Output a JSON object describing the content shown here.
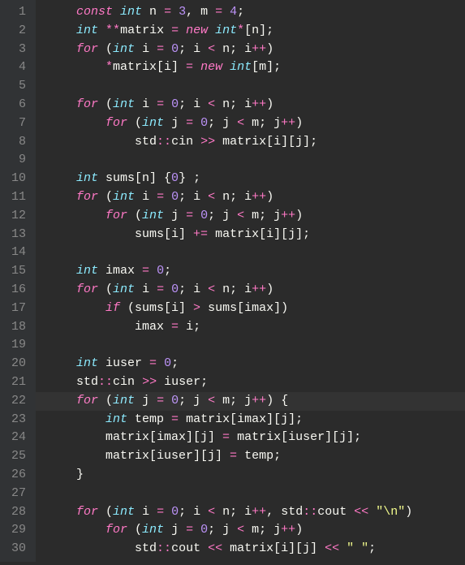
{
  "editor": {
    "cursor_line": 22,
    "lines": [
      {
        "n": 1,
        "indent": 1,
        "tokens": [
          {
            "t": "const ",
            "c": "kw"
          },
          {
            "t": "int",
            "c": "type"
          },
          {
            "t": " n ",
            "c": "id"
          },
          {
            "t": "=",
            "c": "op"
          },
          {
            "t": " ",
            "c": "id"
          },
          {
            "t": "3",
            "c": "num"
          },
          {
            "t": ", m ",
            "c": "id"
          },
          {
            "t": "=",
            "c": "op"
          },
          {
            "t": " ",
            "c": "id"
          },
          {
            "t": "4",
            "c": "num"
          },
          {
            "t": ";",
            "c": "pn"
          }
        ]
      },
      {
        "n": 2,
        "indent": 1,
        "tokens": [
          {
            "t": "int",
            "c": "type"
          },
          {
            "t": " ",
            "c": "id"
          },
          {
            "t": "**",
            "c": "op"
          },
          {
            "t": "matrix ",
            "c": "id"
          },
          {
            "t": "=",
            "c": "op"
          },
          {
            "t": " ",
            "c": "id"
          },
          {
            "t": "new ",
            "c": "kw"
          },
          {
            "t": "int",
            "c": "type"
          },
          {
            "t": "*",
            "c": "op"
          },
          {
            "t": "[n];",
            "c": "pn"
          }
        ]
      },
      {
        "n": 3,
        "indent": 1,
        "tokens": [
          {
            "t": "for",
            "c": "kw"
          },
          {
            "t": " (",
            "c": "pn"
          },
          {
            "t": "int",
            "c": "type"
          },
          {
            "t": " i ",
            "c": "id"
          },
          {
            "t": "=",
            "c": "op"
          },
          {
            "t": " ",
            "c": "id"
          },
          {
            "t": "0",
            "c": "num"
          },
          {
            "t": "; i ",
            "c": "id"
          },
          {
            "t": "<",
            "c": "op"
          },
          {
            "t": " n; i",
            "c": "id"
          },
          {
            "t": "++",
            "c": "op"
          },
          {
            "t": ")",
            "c": "pn"
          }
        ]
      },
      {
        "n": 4,
        "indent": 2,
        "tokens": [
          {
            "t": "*",
            "c": "op"
          },
          {
            "t": "matrix[i] ",
            "c": "id"
          },
          {
            "t": "=",
            "c": "op"
          },
          {
            "t": " ",
            "c": "id"
          },
          {
            "t": "new ",
            "c": "kw"
          },
          {
            "t": "int",
            "c": "type"
          },
          {
            "t": "[m];",
            "c": "pn"
          }
        ]
      },
      {
        "n": 5,
        "indent": 0,
        "tokens": []
      },
      {
        "n": 6,
        "indent": 1,
        "tokens": [
          {
            "t": "for",
            "c": "kw"
          },
          {
            "t": " (",
            "c": "pn"
          },
          {
            "t": "int",
            "c": "type"
          },
          {
            "t": " i ",
            "c": "id"
          },
          {
            "t": "=",
            "c": "op"
          },
          {
            "t": " ",
            "c": "id"
          },
          {
            "t": "0",
            "c": "num"
          },
          {
            "t": "; i ",
            "c": "id"
          },
          {
            "t": "<",
            "c": "op"
          },
          {
            "t": " n; i",
            "c": "id"
          },
          {
            "t": "++",
            "c": "op"
          },
          {
            "t": ")",
            "c": "pn"
          }
        ]
      },
      {
        "n": 7,
        "indent": 2,
        "tokens": [
          {
            "t": "for",
            "c": "kw"
          },
          {
            "t": " (",
            "c": "pn"
          },
          {
            "t": "int",
            "c": "type"
          },
          {
            "t": " j ",
            "c": "id"
          },
          {
            "t": "=",
            "c": "op"
          },
          {
            "t": " ",
            "c": "id"
          },
          {
            "t": "0",
            "c": "num"
          },
          {
            "t": "; j ",
            "c": "id"
          },
          {
            "t": "<",
            "c": "op"
          },
          {
            "t": " m; j",
            "c": "id"
          },
          {
            "t": "++",
            "c": "op"
          },
          {
            "t": ")",
            "c": "pn"
          }
        ]
      },
      {
        "n": 8,
        "indent": 3,
        "tokens": [
          {
            "t": "std",
            "c": "id"
          },
          {
            "t": "::",
            "c": "op"
          },
          {
            "t": "cin ",
            "c": "fn"
          },
          {
            "t": ">>",
            "c": "op"
          },
          {
            "t": " matrix[i][j];",
            "c": "id"
          }
        ]
      },
      {
        "n": 9,
        "indent": 0,
        "tokens": []
      },
      {
        "n": 10,
        "indent": 1,
        "tokens": [
          {
            "t": "int",
            "c": "type"
          },
          {
            "t": " sums[n] {",
            "c": "id"
          },
          {
            "t": "0",
            "c": "num"
          },
          {
            "t": "} ;",
            "c": "id"
          }
        ]
      },
      {
        "n": 11,
        "indent": 1,
        "tokens": [
          {
            "t": "for",
            "c": "kw"
          },
          {
            "t": " (",
            "c": "pn"
          },
          {
            "t": "int",
            "c": "type"
          },
          {
            "t": " i ",
            "c": "id"
          },
          {
            "t": "=",
            "c": "op"
          },
          {
            "t": " ",
            "c": "id"
          },
          {
            "t": "0",
            "c": "num"
          },
          {
            "t": "; i ",
            "c": "id"
          },
          {
            "t": "<",
            "c": "op"
          },
          {
            "t": " n; i",
            "c": "id"
          },
          {
            "t": "++",
            "c": "op"
          },
          {
            "t": ")",
            "c": "pn"
          }
        ]
      },
      {
        "n": 12,
        "indent": 2,
        "tokens": [
          {
            "t": "for",
            "c": "kw"
          },
          {
            "t": " (",
            "c": "pn"
          },
          {
            "t": "int",
            "c": "type"
          },
          {
            "t": " j ",
            "c": "id"
          },
          {
            "t": "=",
            "c": "op"
          },
          {
            "t": " ",
            "c": "id"
          },
          {
            "t": "0",
            "c": "num"
          },
          {
            "t": "; j ",
            "c": "id"
          },
          {
            "t": "<",
            "c": "op"
          },
          {
            "t": " m; j",
            "c": "id"
          },
          {
            "t": "++",
            "c": "op"
          },
          {
            "t": ")",
            "c": "pn"
          }
        ]
      },
      {
        "n": 13,
        "indent": 3,
        "tokens": [
          {
            "t": "sums[i] ",
            "c": "id"
          },
          {
            "t": "+=",
            "c": "op"
          },
          {
            "t": " matrix[i][j];",
            "c": "id"
          }
        ]
      },
      {
        "n": 14,
        "indent": 0,
        "tokens": []
      },
      {
        "n": 15,
        "indent": 1,
        "tokens": [
          {
            "t": "int",
            "c": "type"
          },
          {
            "t": " imax ",
            "c": "id"
          },
          {
            "t": "=",
            "c": "op"
          },
          {
            "t": " ",
            "c": "id"
          },
          {
            "t": "0",
            "c": "num"
          },
          {
            "t": ";",
            "c": "pn"
          }
        ]
      },
      {
        "n": 16,
        "indent": 1,
        "tokens": [
          {
            "t": "for",
            "c": "kw"
          },
          {
            "t": " (",
            "c": "pn"
          },
          {
            "t": "int",
            "c": "type"
          },
          {
            "t": " i ",
            "c": "id"
          },
          {
            "t": "=",
            "c": "op"
          },
          {
            "t": " ",
            "c": "id"
          },
          {
            "t": "0",
            "c": "num"
          },
          {
            "t": "; i ",
            "c": "id"
          },
          {
            "t": "<",
            "c": "op"
          },
          {
            "t": " n; i",
            "c": "id"
          },
          {
            "t": "++",
            "c": "op"
          },
          {
            "t": ")",
            "c": "pn"
          }
        ]
      },
      {
        "n": 17,
        "indent": 2,
        "tokens": [
          {
            "t": "if",
            "c": "kw"
          },
          {
            "t": " (sums[i] ",
            "c": "id"
          },
          {
            "t": ">",
            "c": "op"
          },
          {
            "t": " sums[imax])",
            "c": "id"
          }
        ]
      },
      {
        "n": 18,
        "indent": 3,
        "tokens": [
          {
            "t": "imax ",
            "c": "id"
          },
          {
            "t": "=",
            "c": "op"
          },
          {
            "t": " i;",
            "c": "id"
          }
        ]
      },
      {
        "n": 19,
        "indent": 0,
        "tokens": []
      },
      {
        "n": 20,
        "indent": 1,
        "tokens": [
          {
            "t": "int",
            "c": "type"
          },
          {
            "t": " iuser ",
            "c": "id"
          },
          {
            "t": "=",
            "c": "op"
          },
          {
            "t": " ",
            "c": "id"
          },
          {
            "t": "0",
            "c": "num"
          },
          {
            "t": ";",
            "c": "pn"
          }
        ]
      },
      {
        "n": 21,
        "indent": 1,
        "tokens": [
          {
            "t": "std",
            "c": "id"
          },
          {
            "t": "::",
            "c": "op"
          },
          {
            "t": "cin ",
            "c": "fn"
          },
          {
            "t": ">>",
            "c": "op"
          },
          {
            "t": " iuser;",
            "c": "id"
          }
        ]
      },
      {
        "n": 22,
        "indent": 1,
        "tokens": [
          {
            "t": "for",
            "c": "kw"
          },
          {
            "t": " (",
            "c": "pn"
          },
          {
            "t": "int",
            "c": "type"
          },
          {
            "t": " j ",
            "c": "id"
          },
          {
            "t": "=",
            "c": "op"
          },
          {
            "t": " ",
            "c": "id"
          },
          {
            "t": "0",
            "c": "num"
          },
          {
            "t": "; j ",
            "c": "id"
          },
          {
            "t": "<",
            "c": "op"
          },
          {
            "t": " m; j",
            "c": "id"
          },
          {
            "t": "++",
            "c": "op"
          },
          {
            "t": ") {",
            "c": "pn"
          }
        ]
      },
      {
        "n": 23,
        "indent": 2,
        "tokens": [
          {
            "t": "int",
            "c": "type"
          },
          {
            "t": " temp ",
            "c": "id"
          },
          {
            "t": "=",
            "c": "op"
          },
          {
            "t": " matrix[imax][j];",
            "c": "id"
          }
        ]
      },
      {
        "n": 24,
        "indent": 2,
        "tokens": [
          {
            "t": "matrix[imax][j] ",
            "c": "id"
          },
          {
            "t": "=",
            "c": "op"
          },
          {
            "t": " matrix[iuser][j];",
            "c": "id"
          }
        ]
      },
      {
        "n": 25,
        "indent": 2,
        "tokens": [
          {
            "t": "matrix[iuser][j] ",
            "c": "id"
          },
          {
            "t": "=",
            "c": "op"
          },
          {
            "t": " temp;",
            "c": "id"
          }
        ]
      },
      {
        "n": 26,
        "indent": 1,
        "tokens": [
          {
            "t": "}",
            "c": "pn"
          }
        ]
      },
      {
        "n": 27,
        "indent": 0,
        "tokens": []
      },
      {
        "n": 28,
        "indent": 1,
        "tokens": [
          {
            "t": "for",
            "c": "kw"
          },
          {
            "t": " (",
            "c": "pn"
          },
          {
            "t": "int",
            "c": "type"
          },
          {
            "t": " i ",
            "c": "id"
          },
          {
            "t": "=",
            "c": "op"
          },
          {
            "t": " ",
            "c": "id"
          },
          {
            "t": "0",
            "c": "num"
          },
          {
            "t": "; i ",
            "c": "id"
          },
          {
            "t": "<",
            "c": "op"
          },
          {
            "t": " n; i",
            "c": "id"
          },
          {
            "t": "++",
            "c": "op"
          },
          {
            "t": ", std",
            "c": "id"
          },
          {
            "t": "::",
            "c": "op"
          },
          {
            "t": "cout ",
            "c": "fn"
          },
          {
            "t": "<<",
            "c": "op"
          },
          {
            "t": " ",
            "c": "id"
          },
          {
            "t": "\"\\n\"",
            "c": "str"
          },
          {
            "t": ")",
            "c": "pn"
          }
        ]
      },
      {
        "n": 29,
        "indent": 2,
        "tokens": [
          {
            "t": "for",
            "c": "kw"
          },
          {
            "t": " (",
            "c": "pn"
          },
          {
            "t": "int",
            "c": "type"
          },
          {
            "t": " j ",
            "c": "id"
          },
          {
            "t": "=",
            "c": "op"
          },
          {
            "t": " ",
            "c": "id"
          },
          {
            "t": "0",
            "c": "num"
          },
          {
            "t": "; j ",
            "c": "id"
          },
          {
            "t": "<",
            "c": "op"
          },
          {
            "t": " m; j",
            "c": "id"
          },
          {
            "t": "++",
            "c": "op"
          },
          {
            "t": ")",
            "c": "pn"
          }
        ]
      },
      {
        "n": 30,
        "indent": 3,
        "tokens": [
          {
            "t": "std",
            "c": "id"
          },
          {
            "t": "::",
            "c": "op"
          },
          {
            "t": "cout ",
            "c": "fn"
          },
          {
            "t": "<<",
            "c": "op"
          },
          {
            "t": " matrix[i][j] ",
            "c": "id"
          },
          {
            "t": "<<",
            "c": "op"
          },
          {
            "t": " ",
            "c": "id"
          },
          {
            "t": "\" \"",
            "c": "str"
          },
          {
            "t": ";",
            "c": "pn"
          }
        ]
      }
    ]
  }
}
